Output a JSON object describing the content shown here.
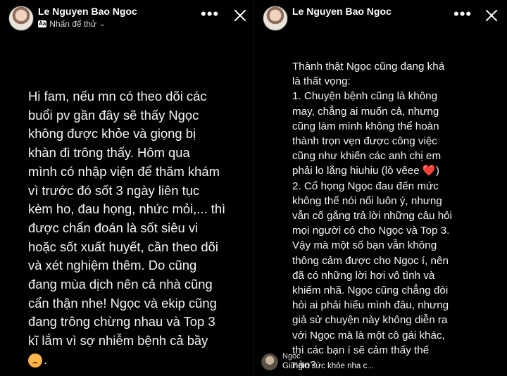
{
  "left": {
    "header": {
      "name": "Le Nguyen Bao Ngoc",
      "subtitle": "Nhấn để thử",
      "badge": "Aa"
    },
    "story_text": "Hi fam, nếu mn có theo dõi các\nbuổi pv gần đây sẽ thấy Ngọc\nkhông được khỏe và giọng bị\nkhàn đi trông thấy. Hôm qua\nmình có nhập viện để thăm khám\nvì trước đó sốt 3 ngày liên tục\nkèm ho, đau họng, nhức mỏi,... thì\nđược chẩn đoán là sốt siêu vi\nhoặc sốt xuất huyết, cần theo dõi\nvà xét nghiệm thêm. Do cũng\nđang mùa dịch nên cả nhà cũng\ncẩn thận nhe! Ngọc và ekip cũng\nđang trông chừng nhau và Top 3\nkĩ lắm vì sợ nhiễm bệnh cả bầy",
    "story_tail": "."
  },
  "right": {
    "header": {
      "name": "Le Nguyen Bao Ngoc"
    },
    "story_text_before_heart": "Thành thật Ngọc cũng đang khá\nlà thất vọng:\n1. Chuyện bệnh cũng là không\nmay, chẳng ai muốn cả, nhưng\ncũng làm mình không thể hoàn\nthành trọn vẹn được công việc\ncũng như khiến các anh chị em\nphải lo lắng hiuhiu (lò vêee ",
    "heart": "❤️",
    "story_text_after_heart": ")\n2. Cổ họng Ngọc đau đến mức\nkhông thể nói nổi luôn ý, nhưng\nvẫn cố gắng trả lời những câu hỏi\nmọi người có cho Ngọc và Top 3.\nVậy mà một số bạn vẫn không\nthông cảm được cho Ngọc í, nên\nđã có những lời hơi vô tình và\nkhiếm nhã. Ngọc cũng chẳng đòi\nhỏi ai phải hiểu mình đâu, nhưng\ngiả sử chuyện này không diễn ra\nvới Ngọc mà là một cô gái khác,\nthì các bạn í sẽ cảm thấy thế\nnào?",
    "reply": {
      "name": "Ngoc",
      "text": "Giữ gìn sức khỏe nha c..."
    }
  },
  "icons": {
    "more": "more-horizontal-icon",
    "close": "close-icon",
    "chevron": "chevron-down-icon",
    "face_emoji": "pleading-face-emoji-icon",
    "heart": "red-heart-icon"
  },
  "colors": {
    "background": "#000000",
    "text": "#ffffff",
    "heart": "#e53935"
  }
}
